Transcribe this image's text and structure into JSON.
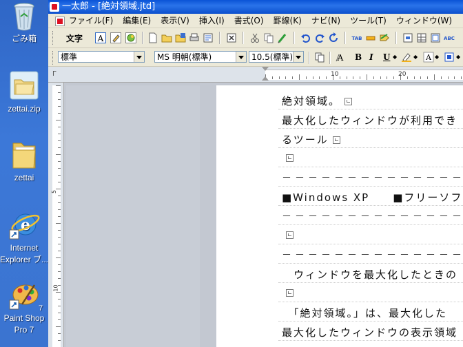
{
  "desktop": {
    "icons": [
      {
        "id": "recycle",
        "label": "ごみ箱"
      },
      {
        "id": "zettai_zip",
        "label": "zettai.zip"
      },
      {
        "id": "zettai_folder",
        "label": "zettai"
      },
      {
        "id": "ie",
        "label_line1": "Internet",
        "label_line2": "Explorer ブ..."
      },
      {
        "id": "paintshop",
        "label_line1": "Paint Shop",
        "label_line2": "Pro 7",
        "badge": "7"
      }
    ]
  },
  "window": {
    "title": "一太郎 - [絶対領域.jtd]"
  },
  "menubar": {
    "items": [
      "ファイル(F)",
      "編集(E)",
      "表示(V)",
      "挿入(I)",
      "書式(O)",
      "罫線(K)",
      "ナビ(N)",
      "ツール(T)",
      "ウィンドウ(W)"
    ]
  },
  "toolbar1": {
    "label": "文字"
  },
  "toolbar2": {
    "style": "標準",
    "font": "MS 明朝(標準)",
    "size": "10.5(標準)",
    "buttons": [
      "B",
      "I",
      "U"
    ]
  },
  "ruler": {
    "numbers": [
      "10",
      "20"
    ],
    "vnumbers": [
      "5",
      "10"
    ]
  },
  "document": {
    "lines": [
      "絶対領域。",
      "最大化したウィンドウが利用でき",
      "るツール",
      "",
      "－－－－－－－－－－－－－－－",
      "■Windows XP　　■フリーソフト",
      "－－－－－－－－－－－－－－－",
      "",
      "－－－－－－－－－－－－－－－",
      "　ウィンドウを最大化したときの",
      "",
      "　「絶対領域。」は、最大化した",
      "最大化したウィンドウの表示領域"
    ]
  }
}
